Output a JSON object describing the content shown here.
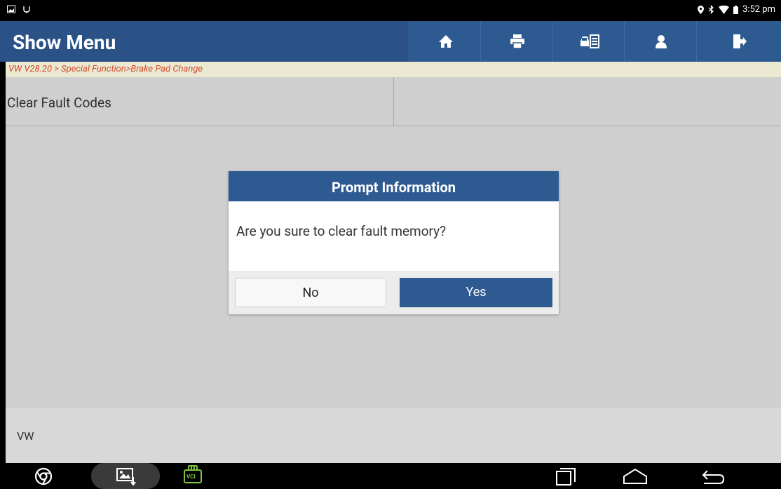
{
  "status_bar": {
    "time": "3:52 pm"
  },
  "header": {
    "title": "Show Menu",
    "buttons": [
      "home-icon",
      "printer-icon",
      "car-report-icon",
      "user-icon",
      "exit-icon"
    ]
  },
  "breadcrumb": "VW V28.20 > Special Function>Brake Pad Change",
  "menu": {
    "items": [
      {
        "label": "Clear Fault Codes"
      }
    ]
  },
  "footer": {
    "label": "VW"
  },
  "dialog": {
    "title": "Prompt Information",
    "message": "Are you sure to clear fault memory?",
    "no_label": "No",
    "yes_label": "Yes"
  },
  "navbar": {
    "vci_label": "VCI"
  },
  "colors": {
    "header_blue": "#2a5287",
    "breadcrumb_red": "#d24b2a",
    "button_blue": "#2e5a92"
  }
}
